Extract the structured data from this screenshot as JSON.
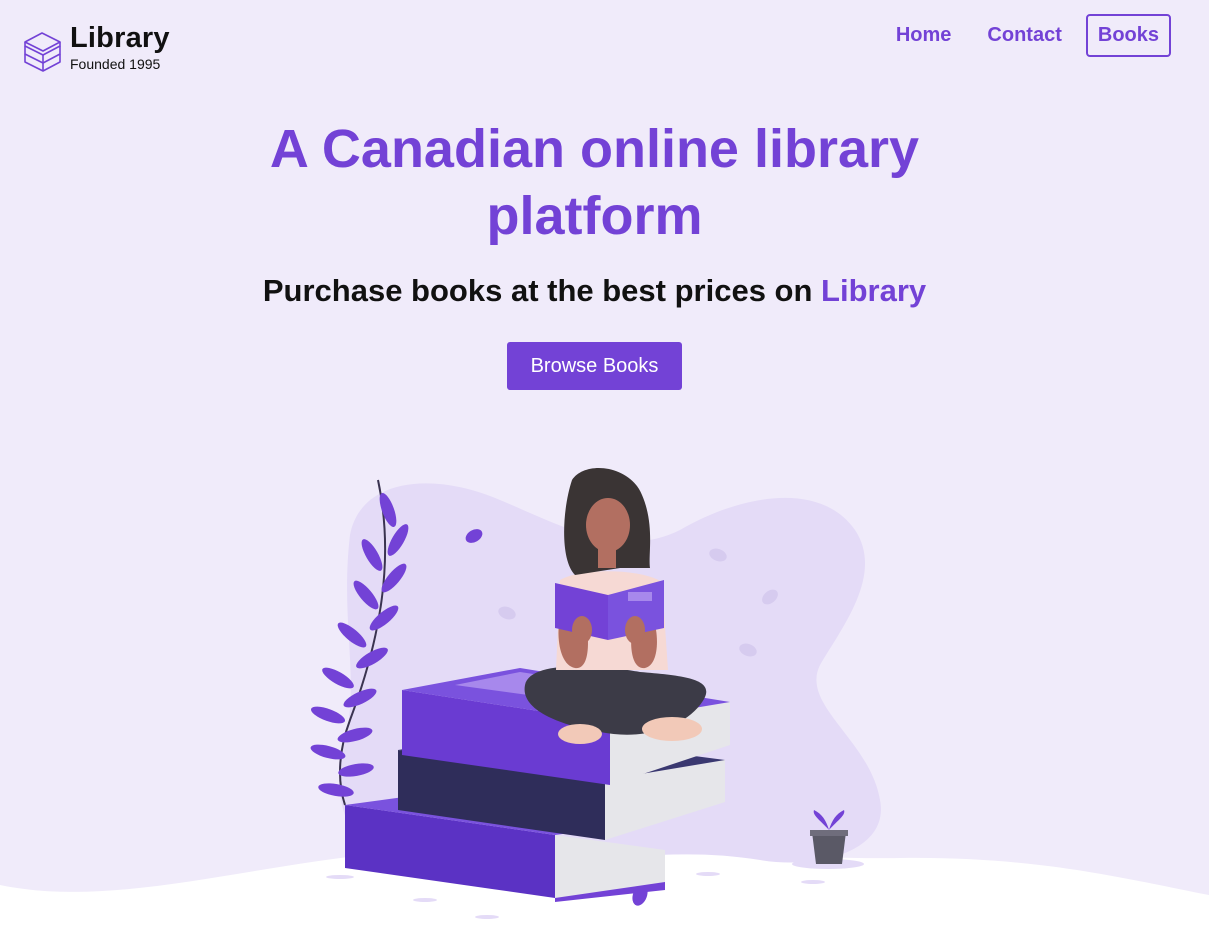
{
  "nav": {
    "logo_title": "Library",
    "logo_subtitle": "Founded 1995",
    "links": [
      {
        "label": "Home"
      },
      {
        "label": "Contact"
      },
      {
        "label": "Books",
        "active": true
      }
    ]
  },
  "hero": {
    "title_line1": "A Canadian online library",
    "title_line2": "platform",
    "subtitle_prefix": "Purchase books at the best prices on ",
    "subtitle_accent": "Library",
    "cta_label": "Browse Books"
  },
  "colors": {
    "accent": "#7342d6",
    "background": "#f0ebfa",
    "text": "#111111"
  },
  "illustration": {
    "name": "woman-reading-on-books-illustration"
  }
}
